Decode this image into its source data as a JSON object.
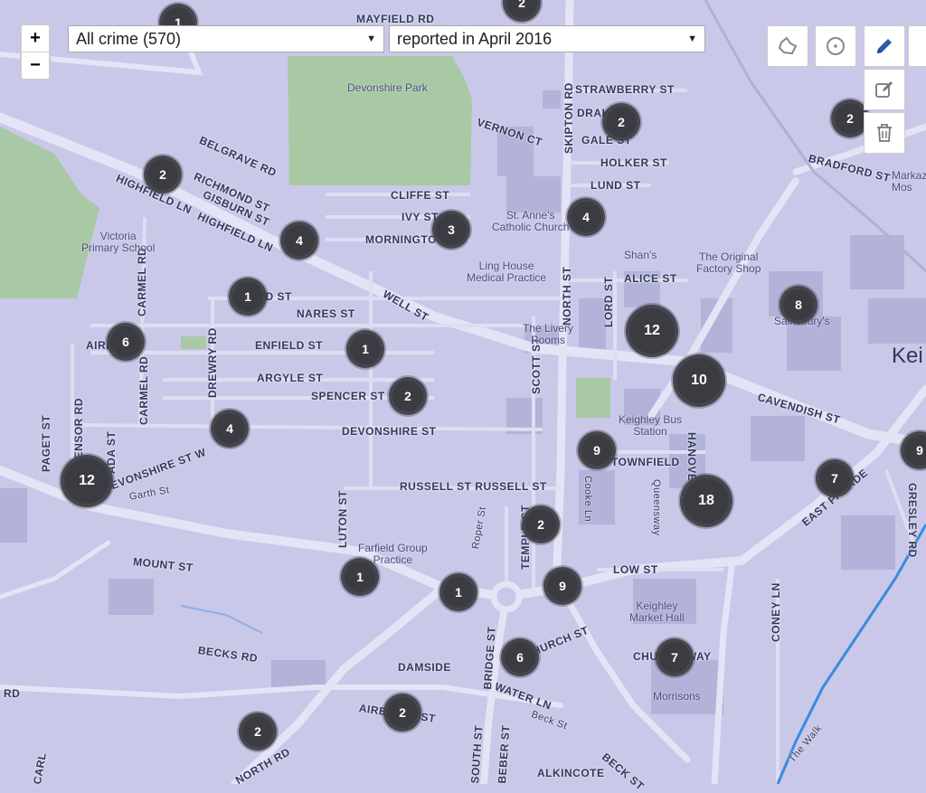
{
  "controls": {
    "zoom_in": "+",
    "zoom_out": "−",
    "crime_filter": "All crime (570)",
    "date_filter": "reported in April 2016"
  },
  "icons": {
    "polygon": "polygon-draw-icon",
    "circle": "circle-draw-icon",
    "pencil": "pencil-icon",
    "edit": "edit-icon",
    "delete": "trash-icon"
  },
  "town": "Kei",
  "streets": [
    "MAYFIELD RD",
    "STRAWBERRY ST",
    "VERNON CT",
    "DRAKE",
    "GALE ST",
    "HOLKER ST",
    "LUND ST",
    "BELGRAVE RD",
    "RICHMOND ST",
    "GISBURN ST",
    "HIGHFIELD LN",
    "HIGHFIELD LN",
    "CLIFFE ST",
    "IVY ST",
    "MORNINGTON",
    "SKIPTON RD",
    "BRADFORD ST",
    "NORTH ST",
    "ALICE ST",
    "LORD ST",
    "WELL ST",
    "NARES ST",
    "ENFIELD ST",
    "ARGYLE ST",
    "SPENCER ST",
    "DEVONSHIRE ST",
    "CARMEL RD",
    "CARMEL RD",
    "DREWRY RD",
    "SCOTT ST",
    "CAVENDISH ST",
    "TOWNFIELD",
    "HANOVER",
    "RUSSELL ST RUSSELL ST",
    "DEVONSHIRE ST W",
    "EDENSOR RD",
    "PAGET ST",
    "ADA ST",
    "LUTON ST",
    "TEMPLE ST",
    "MOUNT ST",
    "LOW ST",
    "CONEY LN",
    "EAST PARADE",
    "GRESLEY RD",
    "CHURCH ST",
    "CHURCH WAY",
    "BECKS RD",
    "DAMSIDE",
    "WATER LN",
    "BRIDGE ST",
    "AIREDALE ST",
    "NORTH RD",
    "SOUTH ST",
    "BEBER ST",
    "ALKINCOTE",
    "BECK ST",
    "GOLD ST",
    "AIRE ST",
    "Garth St",
    "Roper St",
    "Cooke Ln",
    "Queensway",
    "Beck St",
    "The Walk",
    "RD",
    "CARL"
  ],
  "places": [
    "Devonshire Park",
    "Victoria\nPrimary School",
    "St. Anne's\nCatholic Church",
    "Ling House\nMedical Practice",
    "Shan's",
    "The Original\nFactory Shop",
    "The Livery\nRooms",
    "Sainsbury's",
    "Keighley Bus\nStation",
    "Farfield Group\nPractice",
    "Keighley\nMarket Hall",
    "Morrisons",
    "Markaz\nMos"
  ],
  "clusters": [
    {
      "count": "1"
    },
    {
      "count": "2"
    },
    {
      "count": "2"
    },
    {
      "count": "2"
    },
    {
      "count": "2"
    },
    {
      "count": "4"
    },
    {
      "count": "3"
    },
    {
      "count": "4"
    },
    {
      "count": "1"
    },
    {
      "count": "8"
    },
    {
      "count": "12"
    },
    {
      "count": "6"
    },
    {
      "count": "1"
    },
    {
      "count": "10"
    },
    {
      "count": "2"
    },
    {
      "count": "4"
    },
    {
      "count": "9"
    },
    {
      "count": "12"
    },
    {
      "count": "18"
    },
    {
      "count": "7"
    },
    {
      "count": "2"
    },
    {
      "count": "9"
    },
    {
      "count": "1"
    },
    {
      "count": "1"
    },
    {
      "count": "6"
    },
    {
      "count": "7"
    },
    {
      "count": "2"
    },
    {
      "count": "2"
    },
    {
      "count": "9"
    }
  ],
  "colors": {
    "map_bg": "#c9c8e8",
    "road": "#e4e4f6",
    "park": "#a8c9a4",
    "cluster": "#3b3b42",
    "pencil": "#2b5aa8"
  }
}
